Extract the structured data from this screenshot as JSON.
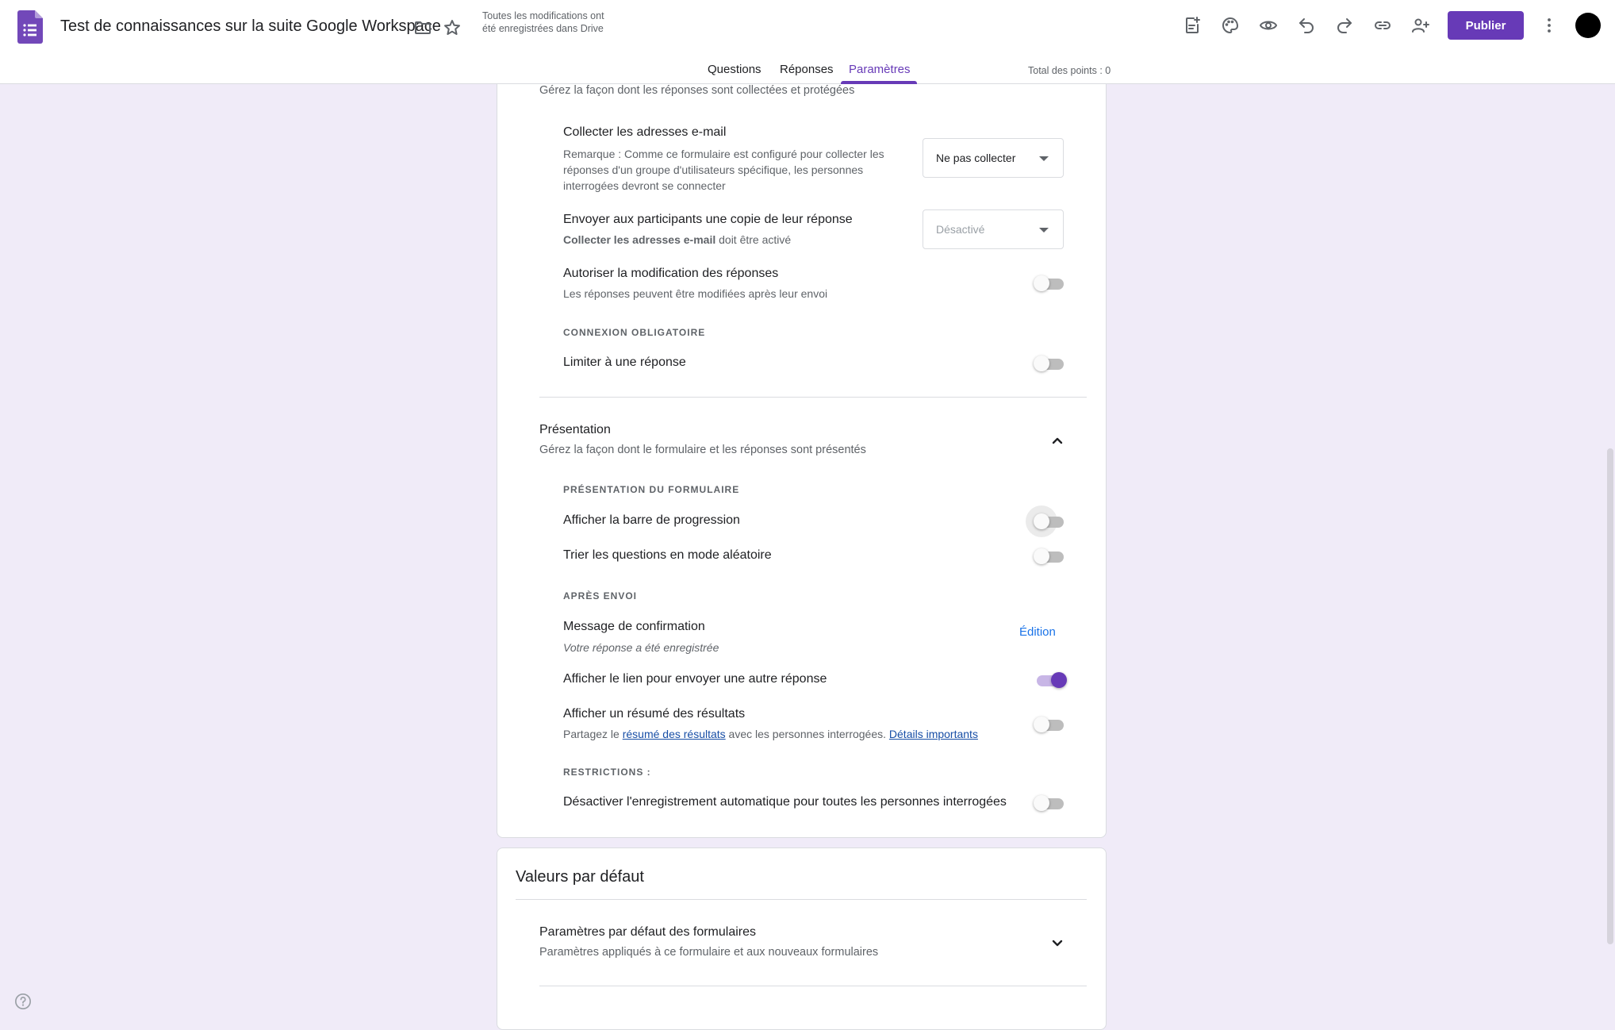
{
  "header": {
    "doc_title": "Test de connaissances sur la suite Google Workspace",
    "save_status": "Toutes les modifications ont été enregistrées dans Drive",
    "publish_label": "Publier",
    "icons": [
      "forms-app-icon",
      "folder-icon",
      "star-icon",
      "add-on-icon",
      "palette-icon",
      "preview-eye-icon",
      "undo-icon",
      "redo-icon",
      "link-icon",
      "add-collaborator-icon",
      "more-vert-icon",
      "avatar"
    ]
  },
  "tabs": {
    "items": [
      "Questions",
      "Réponses",
      "Paramètres"
    ],
    "active": "Paramètres",
    "points_total": "Total des points : 0"
  },
  "responses_section": {
    "subtitle": "Gérez la façon dont les réponses sont collectées et protégées",
    "collect_email": {
      "title": "Collecter les adresses e-mail",
      "desc_lines": [
        "Remarque : Comme ce formulaire est configuré pour collecter les",
        "réponses d'un groupe d'utilisateurs spécifique, les personnes",
        "interrogées devront se connecter"
      ],
      "select_value": "Ne pas collecter"
    },
    "send_copy": {
      "title": "Envoyer aux participants une copie de leur réponse",
      "desc_bold": "Collecter les adresses e-mail",
      "desc_rest": " doit être activé",
      "select_value": "Désactivé"
    },
    "allow_edit": {
      "title": "Autoriser la modification des réponses",
      "desc": "Les réponses peuvent être modifiées après leur envoi",
      "enabled": false
    },
    "signin_header": "CONNEXION OBLIGATOIRE",
    "limit_one": {
      "title": "Limiter à une réponse",
      "enabled": false
    }
  },
  "presentation_section": {
    "title": "Présentation",
    "subtitle": "Gérez la façon dont le formulaire et les réponses sont présentés",
    "form_presentation_header": "PRÉSENTATION DU FORMULAIRE",
    "progress_bar": {
      "title": "Afficher la barre de progression",
      "enabled": false
    },
    "shuffle": {
      "title": "Trier les questions en mode aléatoire",
      "enabled": false
    },
    "after_submit_header": "APRÈS ENVOI",
    "confirmation": {
      "title": "Message de confirmation",
      "message": "Votre réponse a été enregistrée",
      "edit_label": "Édition"
    },
    "another_response": {
      "title": "Afficher le lien pour envoyer une autre réponse",
      "enabled": true
    },
    "results_summary": {
      "title": "Afficher un résumé des résultats",
      "desc_prefix": "Partagez le ",
      "desc_link": "résumé des résultats",
      "desc_middle": " avec les personnes interrogées. ",
      "desc_link2": "Détails importants",
      "enabled": false
    },
    "restrictions_header": "RESTRICTIONS :",
    "disable_autosave": {
      "title": "Désactiver l'enregistrement automatique pour toutes les personnes interrogées",
      "enabled": false
    }
  },
  "defaults_section": {
    "title": "Valeurs par défaut",
    "form_defaults": {
      "title": "Paramètres par défaut des formulaires",
      "desc": "Paramètres appliqués à ce formulaire et aux nouveaux formulaires"
    }
  },
  "colors": {
    "accent": "#673ab7",
    "background": "#f0ebf8",
    "link": "#1a73e8"
  }
}
